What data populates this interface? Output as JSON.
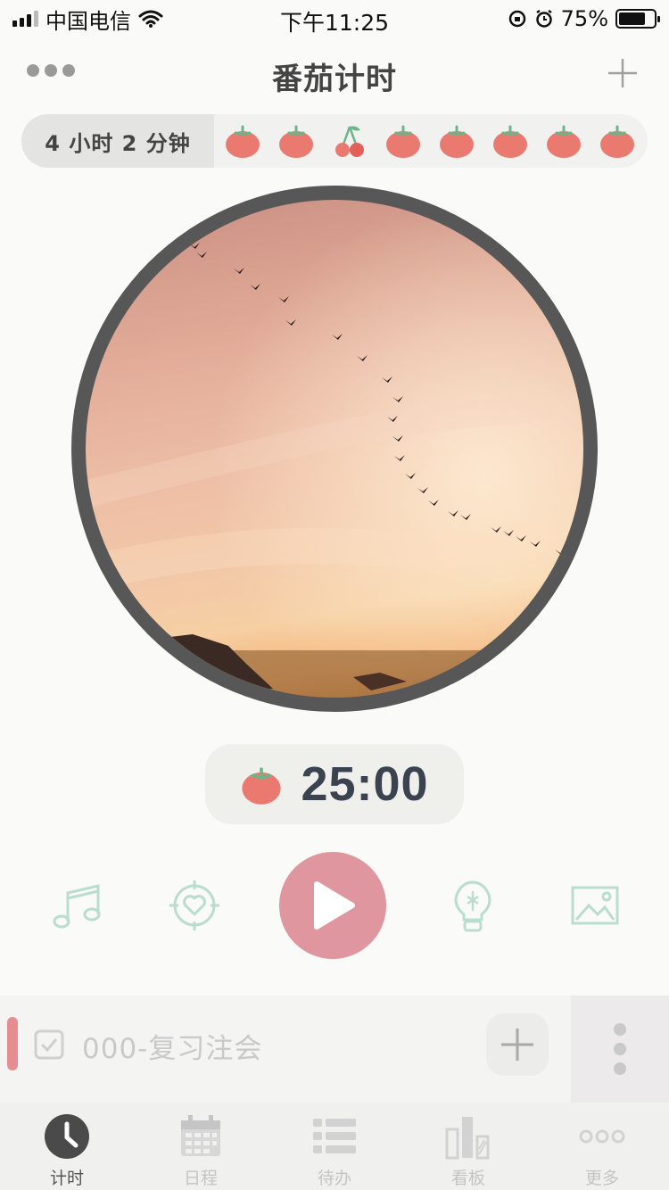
{
  "status_bar": {
    "carrier": "中国电信",
    "time": "下午11:25",
    "battery_percent": "75%",
    "battery_level": 0.75
  },
  "header": {
    "title": "番茄计时",
    "more_icon": "ellipsis-icon",
    "add_icon": "plus-icon"
  },
  "pomodoro_bar": {
    "total_time": "4 小时  2 分钟",
    "items": [
      "tomato",
      "tomato",
      "cherry",
      "tomato",
      "tomato",
      "tomato",
      "tomato",
      "tomato"
    ]
  },
  "dial": {
    "image": "sunset-sky-with-birds"
  },
  "timer": {
    "icon": "tomato-icon",
    "time": "25:00"
  },
  "controls": {
    "music_icon": "music-note-icon",
    "focus_icon": "target-heart-icon",
    "play_icon": "play-icon",
    "idea_icon": "lightbulb-icon",
    "image_icon": "image-icon",
    "accent_color": "#e0969e",
    "icon_color": "#b9ddd0"
  },
  "task": {
    "title": "000-复习注会",
    "accent_color": "#e68d92"
  },
  "tabbar": {
    "tabs": [
      {
        "label": "计时",
        "icon": "clock-icon",
        "active": true
      },
      {
        "label": "日程",
        "icon": "calendar-icon",
        "active": false
      },
      {
        "label": "待办",
        "icon": "list-icon",
        "active": false
      },
      {
        "label": "看板",
        "icon": "chart-icon",
        "active": false
      },
      {
        "label": "更多",
        "icon": "more-icon",
        "active": false
      }
    ]
  }
}
